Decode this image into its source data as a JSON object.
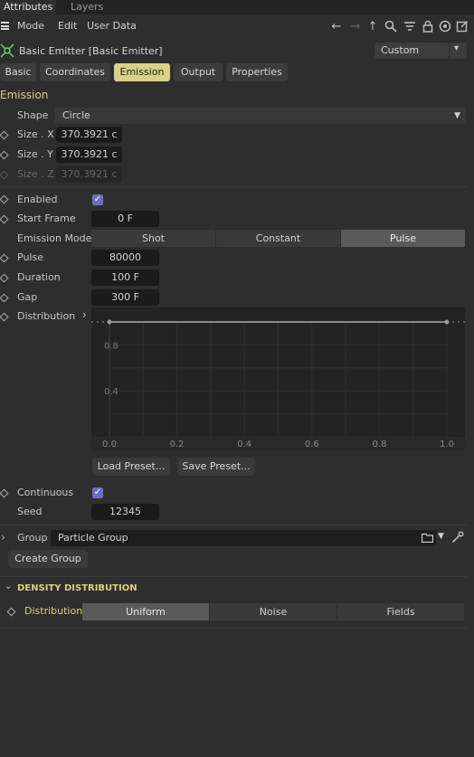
{
  "top_tabs": [
    "Attributes",
    "Layers"
  ],
  "menu": [
    "Mode",
    "Edit",
    "User Data"
  ],
  "object": {
    "title": "Basic Emitter [Basic Emitter]",
    "preset_value": "Custom"
  },
  "tabs": [
    "Basic",
    "Coordinates",
    "Emission",
    "Output",
    "Properties"
  ],
  "active_tab": "Emission",
  "emission": {
    "section_title": "Emission",
    "shape_label": "Shape",
    "shape_value": "Circle",
    "size_x_label": "Size . X",
    "size_x": "370.3921 c",
    "size_y_label": "Size . Y",
    "size_y": "370.3921 c",
    "size_z_label": "Size . Z",
    "size_z": "370.3921 c",
    "enabled_label": "Enabled",
    "enabled_checked": true,
    "start_frame_label": "Start Frame",
    "start_frame": "0 F",
    "mode_label": "Emission Mode",
    "modes": [
      "Shot",
      "Constant",
      "Pulse"
    ],
    "active_mode": "Pulse",
    "pulse_label": "Pulse",
    "pulse": "80000",
    "duration_label": "Duration",
    "duration": "100 F",
    "gap_label": "Gap",
    "gap": "300 F",
    "distribution_label": "Distribution",
    "load_preset": "Load Preset...",
    "save_preset": "Save Preset...",
    "continuous_label": "Continuous",
    "continuous_checked": true,
    "seed_label": "Seed",
    "seed": "12345",
    "group_label": "Group",
    "group_value": "Particle Group",
    "create_group": "Create Group"
  },
  "distribution_graph": {
    "x_ticks": [
      "0.0",
      "0.2",
      "0.4",
      "0.6",
      "0.8",
      "1.0"
    ],
    "y_ticks": [
      "0.8",
      "0.4"
    ],
    "curve": [
      [
        0.0,
        1.0
      ],
      [
        1.0,
        1.0
      ]
    ]
  },
  "density": {
    "section_title": "DENSITY DISTRIBUTION",
    "distribution_label": "Distribution",
    "options": [
      "Uniform",
      "Noise",
      "Fields"
    ],
    "active": "Uniform"
  },
  "colors": {
    "accent": "#d9d189",
    "check": "#6b6bc4",
    "background": "#2e2e2e"
  }
}
